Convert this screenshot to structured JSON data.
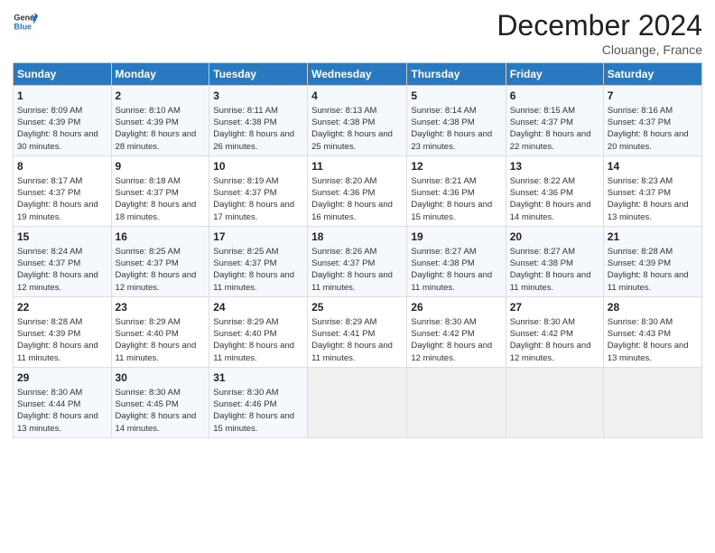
{
  "logo": {
    "line1": "General",
    "line2": "Blue"
  },
  "header": {
    "month": "December 2024",
    "location": "Clouange, France"
  },
  "days_of_week": [
    "Sunday",
    "Monday",
    "Tuesday",
    "Wednesday",
    "Thursday",
    "Friday",
    "Saturday"
  ],
  "weeks": [
    [
      {
        "day": "1",
        "sunrise": "Sunrise: 8:09 AM",
        "sunset": "Sunset: 4:39 PM",
        "daylight": "Daylight: 8 hours and 30 minutes."
      },
      {
        "day": "2",
        "sunrise": "Sunrise: 8:10 AM",
        "sunset": "Sunset: 4:39 PM",
        "daylight": "Daylight: 8 hours and 28 minutes."
      },
      {
        "day": "3",
        "sunrise": "Sunrise: 8:11 AM",
        "sunset": "Sunset: 4:38 PM",
        "daylight": "Daylight: 8 hours and 26 minutes."
      },
      {
        "day": "4",
        "sunrise": "Sunrise: 8:13 AM",
        "sunset": "Sunset: 4:38 PM",
        "daylight": "Daylight: 8 hours and 25 minutes."
      },
      {
        "day": "5",
        "sunrise": "Sunrise: 8:14 AM",
        "sunset": "Sunset: 4:38 PM",
        "daylight": "Daylight: 8 hours and 23 minutes."
      },
      {
        "day": "6",
        "sunrise": "Sunrise: 8:15 AM",
        "sunset": "Sunset: 4:37 PM",
        "daylight": "Daylight: 8 hours and 22 minutes."
      },
      {
        "day": "7",
        "sunrise": "Sunrise: 8:16 AM",
        "sunset": "Sunset: 4:37 PM",
        "daylight": "Daylight: 8 hours and 20 minutes."
      }
    ],
    [
      {
        "day": "8",
        "sunrise": "Sunrise: 8:17 AM",
        "sunset": "Sunset: 4:37 PM",
        "daylight": "Daylight: 8 hours and 19 minutes."
      },
      {
        "day": "9",
        "sunrise": "Sunrise: 8:18 AM",
        "sunset": "Sunset: 4:37 PM",
        "daylight": "Daylight: 8 hours and 18 minutes."
      },
      {
        "day": "10",
        "sunrise": "Sunrise: 8:19 AM",
        "sunset": "Sunset: 4:37 PM",
        "daylight": "Daylight: 8 hours and 17 minutes."
      },
      {
        "day": "11",
        "sunrise": "Sunrise: 8:20 AM",
        "sunset": "Sunset: 4:36 PM",
        "daylight": "Daylight: 8 hours and 16 minutes."
      },
      {
        "day": "12",
        "sunrise": "Sunrise: 8:21 AM",
        "sunset": "Sunset: 4:36 PM",
        "daylight": "Daylight: 8 hours and 15 minutes."
      },
      {
        "day": "13",
        "sunrise": "Sunrise: 8:22 AM",
        "sunset": "Sunset: 4:36 PM",
        "daylight": "Daylight: 8 hours and 14 minutes."
      },
      {
        "day": "14",
        "sunrise": "Sunrise: 8:23 AM",
        "sunset": "Sunset: 4:37 PM",
        "daylight": "Daylight: 8 hours and 13 minutes."
      }
    ],
    [
      {
        "day": "15",
        "sunrise": "Sunrise: 8:24 AM",
        "sunset": "Sunset: 4:37 PM",
        "daylight": "Daylight: 8 hours and 12 minutes."
      },
      {
        "day": "16",
        "sunrise": "Sunrise: 8:25 AM",
        "sunset": "Sunset: 4:37 PM",
        "daylight": "Daylight: 8 hours and 12 minutes."
      },
      {
        "day": "17",
        "sunrise": "Sunrise: 8:25 AM",
        "sunset": "Sunset: 4:37 PM",
        "daylight": "Daylight: 8 hours and 11 minutes."
      },
      {
        "day": "18",
        "sunrise": "Sunrise: 8:26 AM",
        "sunset": "Sunset: 4:37 PM",
        "daylight": "Daylight: 8 hours and 11 minutes."
      },
      {
        "day": "19",
        "sunrise": "Sunrise: 8:27 AM",
        "sunset": "Sunset: 4:38 PM",
        "daylight": "Daylight: 8 hours and 11 minutes."
      },
      {
        "day": "20",
        "sunrise": "Sunrise: 8:27 AM",
        "sunset": "Sunset: 4:38 PM",
        "daylight": "Daylight: 8 hours and 11 minutes."
      },
      {
        "day": "21",
        "sunrise": "Sunrise: 8:28 AM",
        "sunset": "Sunset: 4:39 PM",
        "daylight": "Daylight: 8 hours and 11 minutes."
      }
    ],
    [
      {
        "day": "22",
        "sunrise": "Sunrise: 8:28 AM",
        "sunset": "Sunset: 4:39 PM",
        "daylight": "Daylight: 8 hours and 11 minutes."
      },
      {
        "day": "23",
        "sunrise": "Sunrise: 8:29 AM",
        "sunset": "Sunset: 4:40 PM",
        "daylight": "Daylight: 8 hours and 11 minutes."
      },
      {
        "day": "24",
        "sunrise": "Sunrise: 8:29 AM",
        "sunset": "Sunset: 4:40 PM",
        "daylight": "Daylight: 8 hours and 11 minutes."
      },
      {
        "day": "25",
        "sunrise": "Sunrise: 8:29 AM",
        "sunset": "Sunset: 4:41 PM",
        "daylight": "Daylight: 8 hours and 11 minutes."
      },
      {
        "day": "26",
        "sunrise": "Sunrise: 8:30 AM",
        "sunset": "Sunset: 4:42 PM",
        "daylight": "Daylight: 8 hours and 12 minutes."
      },
      {
        "day": "27",
        "sunrise": "Sunrise: 8:30 AM",
        "sunset": "Sunset: 4:42 PM",
        "daylight": "Daylight: 8 hours and 12 minutes."
      },
      {
        "day": "28",
        "sunrise": "Sunrise: 8:30 AM",
        "sunset": "Sunset: 4:43 PM",
        "daylight": "Daylight: 8 hours and 13 minutes."
      }
    ],
    [
      {
        "day": "29",
        "sunrise": "Sunrise: 8:30 AM",
        "sunset": "Sunset: 4:44 PM",
        "daylight": "Daylight: 8 hours and 13 minutes."
      },
      {
        "day": "30",
        "sunrise": "Sunrise: 8:30 AM",
        "sunset": "Sunset: 4:45 PM",
        "daylight": "Daylight: 8 hours and 14 minutes."
      },
      {
        "day": "31",
        "sunrise": "Sunrise: 8:30 AM",
        "sunset": "Sunset: 4:46 PM",
        "daylight": "Daylight: 8 hours and 15 minutes."
      },
      null,
      null,
      null,
      null
    ]
  ]
}
